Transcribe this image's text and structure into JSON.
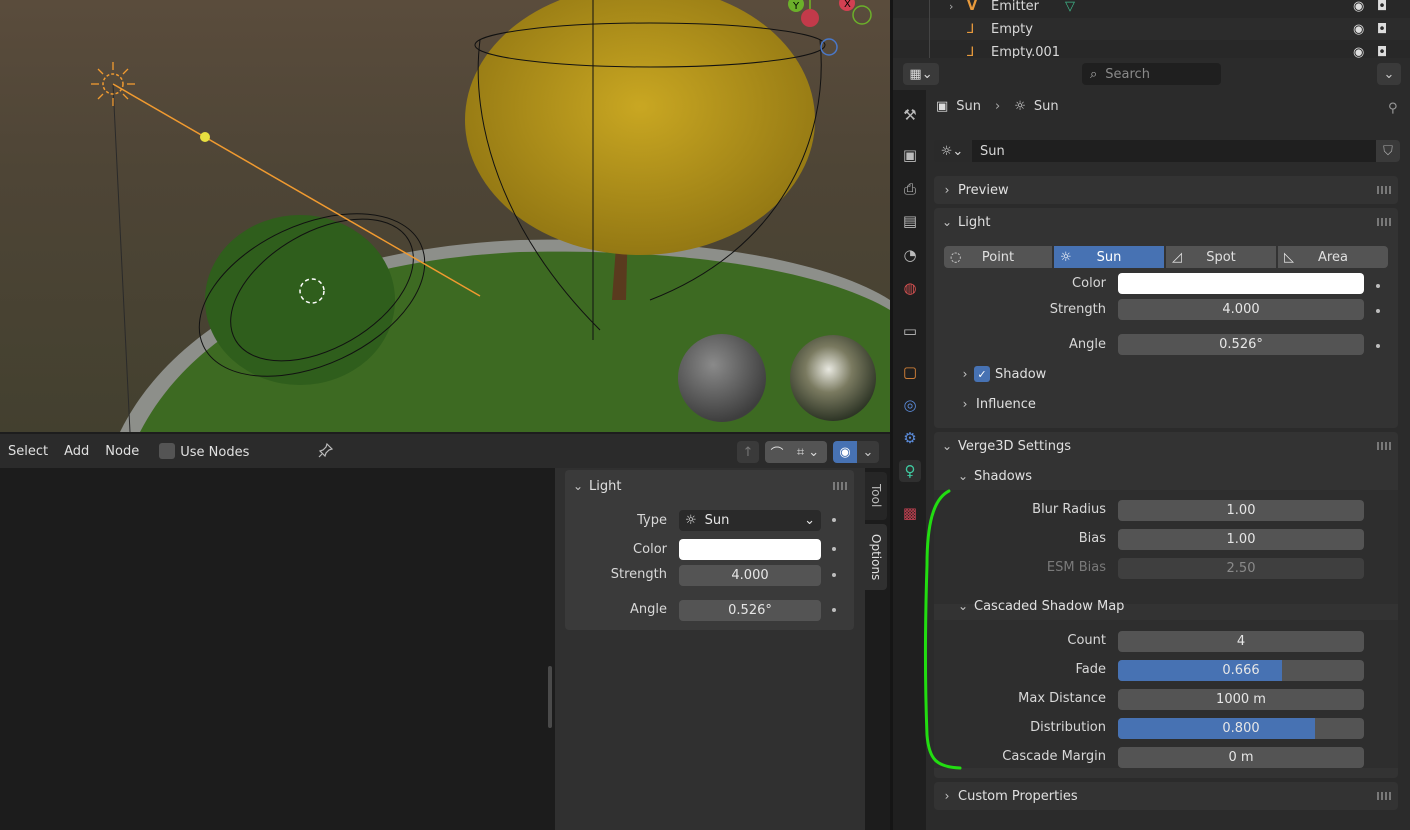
{
  "viewport": {
    "gizmo_y": "Y",
    "gizmo_x": "X"
  },
  "outliner": {
    "rows": [
      {
        "label": "Emitter"
      },
      {
        "label": "Empty"
      },
      {
        "label": "Empty.001"
      }
    ]
  },
  "node_editor": {
    "menu": [
      "Select",
      "Add",
      "Node"
    ],
    "use_nodes_label": "Use Nodes",
    "tabs": {
      "tool": "Tool",
      "options": "Options"
    },
    "panel": {
      "title": "Light",
      "type_label": "Type",
      "type_value": "Sun",
      "color_label": "Color",
      "strength_label": "Strength",
      "strength_value": "4.000",
      "angle_label": "Angle",
      "angle_value": "0.526°"
    }
  },
  "properties": {
    "search_placeholder": "Search",
    "breadcrumb": {
      "object": "Sun",
      "data": "Sun"
    },
    "datablock_name": "Sun",
    "preview_title": "Preview",
    "light_title": "Light",
    "light_types": [
      {
        "label": "Point",
        "active": false
      },
      {
        "label": "Sun",
        "active": true
      },
      {
        "label": "Spot",
        "active": false
      },
      {
        "label": "Area",
        "active": false
      }
    ],
    "color_label": "Color",
    "color_value": "#ffffff",
    "strength_label": "Strength",
    "strength_value": "4.000",
    "angle_label": "Angle",
    "angle_value": "0.526°",
    "shadow_label": "Shadow",
    "shadow_checked": true,
    "influence_label": "Influence",
    "verge_title": "Verge3D Settings",
    "shadows_title": "Shadows",
    "blur_radius_label": "Blur Radius",
    "blur_radius_value": "1.00",
    "bias_label": "Bias",
    "bias_value": "1.00",
    "esm_bias_label": "ESM Bias",
    "esm_bias_value": "2.50",
    "csm_title": "Cascaded Shadow Map",
    "count_label": "Count",
    "count_value": "4",
    "fade_label": "Fade",
    "fade_value": "0.666",
    "fade_fraction": 0.666,
    "max_distance_label": "Max Distance",
    "max_distance_value": "1000 m",
    "distribution_label": "Distribution",
    "distribution_value": "0.800",
    "distribution_fraction": 0.8,
    "cascade_margin_label": "Cascade Margin",
    "cascade_margin_value": "0 m",
    "custom_props_title": "Custom Properties"
  },
  "colors": {
    "accent": "#4772b3",
    "annotation": "#22dd11",
    "light_line": "#f09a30"
  }
}
